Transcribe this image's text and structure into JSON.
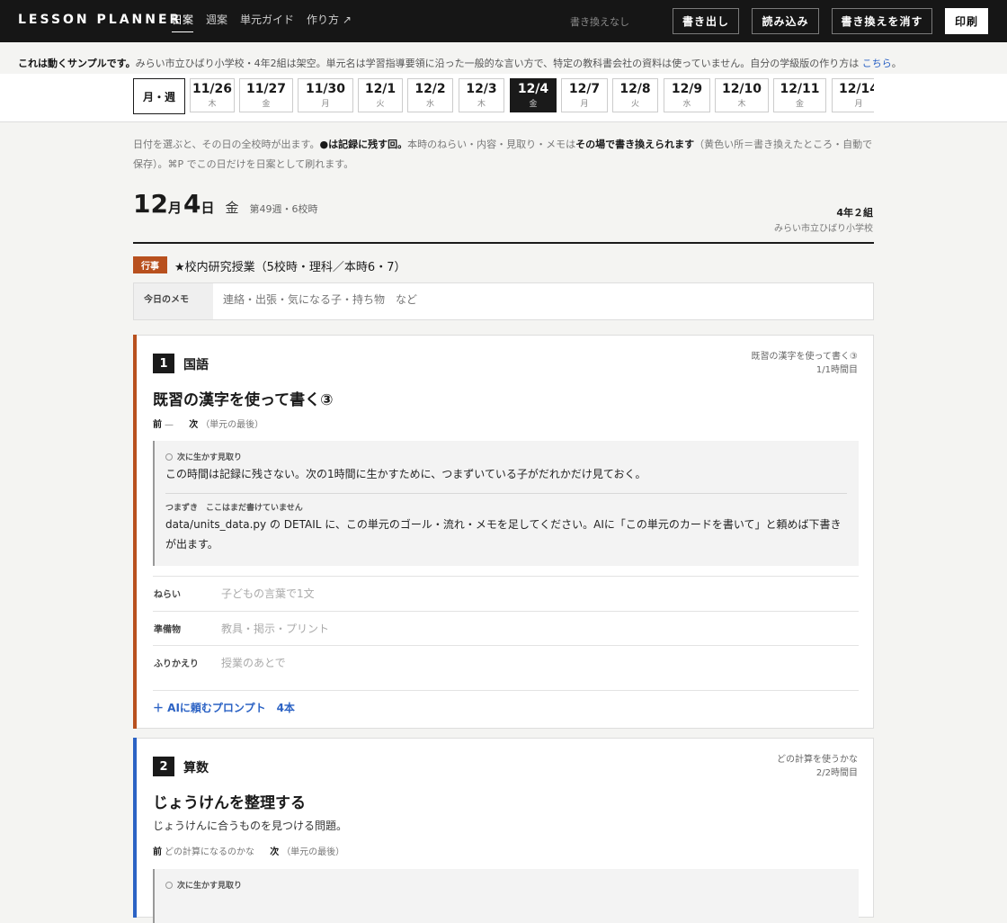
{
  "app": {
    "brand": "LESSON PLANNER"
  },
  "nav": [
    "日案",
    "週案",
    "単元ガイド",
    "作り方 ↗"
  ],
  "status": "書き換えなし",
  "buttons": {
    "export": "書き出し",
    "import": "読み込み",
    "clear": "書き換えを消す",
    "print": "印刷"
  },
  "notice": {
    "bold": "これは動くサンプルです。",
    "text": "みらい市立ひばり小学校・4年2組は架空。単元名は学習指導要領に沿った一般的な言い方で、特定の教科書会社の資料は使っていません。自分の学級版の作り方は",
    "link": "こちら",
    "end": "。"
  },
  "week_button": "月・週",
  "days": [
    {
      "date": "11/26",
      "dow": "木"
    },
    {
      "date": "11/27",
      "dow": "金"
    },
    {
      "date": "11/30",
      "dow": "月"
    },
    {
      "date": "12/1",
      "dow": "火"
    },
    {
      "date": "12/2",
      "dow": "水"
    },
    {
      "date": "12/3",
      "dow": "木"
    },
    {
      "date": "12/4",
      "dow": "金",
      "active": true
    },
    {
      "date": "12/7",
      "dow": "月"
    },
    {
      "date": "12/8",
      "dow": "火"
    },
    {
      "date": "12/9",
      "dow": "水"
    },
    {
      "date": "12/10",
      "dow": "木"
    },
    {
      "date": "12/11",
      "dow": "金"
    },
    {
      "date": "12/14",
      "dow": "月"
    }
  ],
  "helper": {
    "p1": "日付を選ぶと、その日の全校時が出ます。",
    "b1": "●は記録に残す回。",
    "p2": "本時のねらい・内容・見取り・メモは",
    "b2": "その場で書き換えられます",
    "p3": "（黄色い所＝書き換えたところ・自動で保存）。⌘P でこの日だけを日案として刷れます。"
  },
  "day": {
    "month": "12",
    "month_unit": "月",
    "day": "4",
    "day_unit": "日",
    "weekday": "金",
    "meta": "第49週・6校時",
    "class": "4年２組",
    "school": "みらい市立ひばり小学校"
  },
  "event": {
    "tag": "行事",
    "text": "★校内研究授業（5校時・理科／本時6・7）"
  },
  "memo": {
    "label": "今日のメモ",
    "placeholder": "連絡・出張・気になる子・持ち物　など"
  },
  "periods": [
    {
      "num": "1",
      "subject": "国語",
      "unit": "既習の漢字を使って書く③",
      "hour": "1/1時間目",
      "title": "既習の漢字を使って書く③",
      "prev_label": "前",
      "prev": "—",
      "next_label": "次",
      "next": "（単元の最後）",
      "observe_label": "次に生かす見取り",
      "observe": "この時間は記録に残さない。次の1時間に生かすために、つまずいている子がだれかだけ見ておく。",
      "stumble_label": "つまずき　ここはまだ書けていません",
      "stumble": "data/units_data.py の DETAIL に、この単元のゴール・流れ・メモを足してください。AIに「この単元のカードを書いて」と頼めば下書きが出ます。",
      "fields": [
        {
          "label": "ねらい",
          "placeholder": "子どもの言葉で1文"
        },
        {
          "label": "準備物",
          "placeholder": "教具・掲示・プリント"
        },
        {
          "label": "ふりかえり",
          "placeholder": "授業のあとで"
        }
      ],
      "ai_prompt": "＋ AIに頼むプロンプト　4本",
      "color": "#b8501e"
    },
    {
      "num": "2",
      "subject": "算数",
      "unit": "どの計算を使うかな",
      "hour": "2/2時間目",
      "title": "じょうけんを整理する",
      "description": "じょうけんに合うものを見つける問題。",
      "prev_label": "前",
      "prev": "どの計算になるのかな",
      "next_label": "次",
      "next": "（単元の最後）",
      "observe_label": "次に生かす見取り",
      "color": "#2b62c4"
    }
  ]
}
